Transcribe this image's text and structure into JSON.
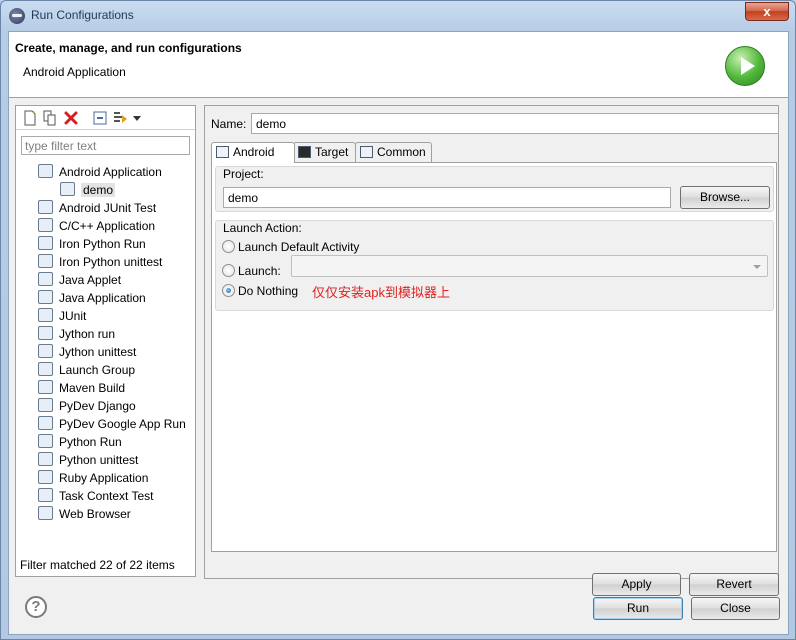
{
  "window": {
    "title": "Run Configurations",
    "close_glyph": "x"
  },
  "header": {
    "title": "Create, manage, and run configurations",
    "subtitle": "Android Application"
  },
  "left": {
    "filter_placeholder": "type filter text",
    "tree": [
      {
        "label": "Android Application",
        "icon": "android-app-icon",
        "level": 0
      },
      {
        "label": "demo",
        "icon": "android-config-icon",
        "level": 1,
        "selected": true
      },
      {
        "label": "Android JUnit Test",
        "icon": "android-junit-icon",
        "level": 0
      },
      {
        "label": "C/C++ Application",
        "icon": "cpp-app-icon",
        "level": 0
      },
      {
        "label": "Iron Python Run",
        "icon": "iron-python-run-icon",
        "level": 0
      },
      {
        "label": "Iron Python unittest",
        "icon": "iron-python-unittest-icon",
        "level": 0
      },
      {
        "label": "Java Applet",
        "icon": "java-applet-icon",
        "level": 0
      },
      {
        "label": "Java Application",
        "icon": "java-app-icon",
        "level": 0
      },
      {
        "label": "JUnit",
        "icon": "junit-icon",
        "level": 0
      },
      {
        "label": "Jython run",
        "icon": "jython-run-icon",
        "level": 0
      },
      {
        "label": "Jython unittest",
        "icon": "jython-unittest-icon",
        "level": 0
      },
      {
        "label": "Launch Group",
        "icon": "launch-group-icon",
        "level": 0
      },
      {
        "label": "Maven Build",
        "icon": "maven-icon",
        "level": 0
      },
      {
        "label": "PyDev Django",
        "icon": "django-icon",
        "level": 0
      },
      {
        "label": "PyDev Google App Run",
        "icon": "google-app-icon",
        "level": 0
      },
      {
        "label": "Python Run",
        "icon": "python-run-icon",
        "level": 0
      },
      {
        "label": "Python unittest",
        "icon": "python-unittest-icon",
        "level": 0
      },
      {
        "label": "Ruby Application",
        "icon": "ruby-icon",
        "level": 0
      },
      {
        "label": "Task Context Test",
        "icon": "task-context-icon",
        "level": 0
      },
      {
        "label": "Web Browser",
        "icon": "web-browser-icon",
        "level": 0
      }
    ],
    "status": "Filter matched 22 of 22 items"
  },
  "right": {
    "name_label": "Name:",
    "name_value": "demo",
    "tabs": [
      {
        "label": "Android",
        "active": true,
        "icon": "android-tab-icon"
      },
      {
        "label": "Target",
        "active": false,
        "icon": "target-tab-icon"
      },
      {
        "label": "Common",
        "active": false,
        "icon": "common-tab-icon"
      }
    ],
    "project_label": "Project:",
    "project_value": "demo",
    "browse_label": "Browse...",
    "launch_action_label": "Launch Action:",
    "radio_default": "Launch Default Activity",
    "radio_launch": "Launch:",
    "radio_nothing": "Do Nothing",
    "annotation": "仅仅安装apk到模拟器上",
    "apply_label": "Apply",
    "revert_label": "Revert"
  },
  "footer": {
    "run_label": "Run",
    "close_label": "Close",
    "help_glyph": "?"
  },
  "colors": {
    "annotation": "#e02020",
    "accent": "#3c7fb1"
  }
}
